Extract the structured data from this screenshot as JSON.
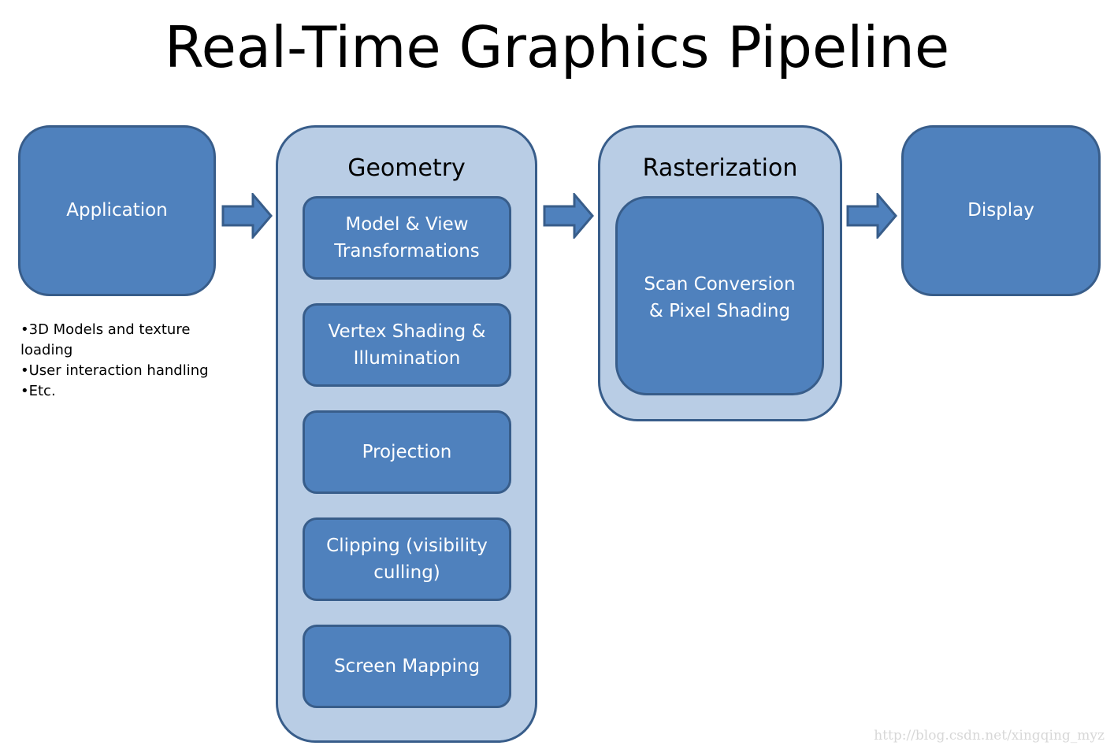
{
  "title": "Real-Time Graphics Pipeline",
  "stages": {
    "application": {
      "label": "Application"
    },
    "geometry": {
      "label": "Geometry",
      "steps": [
        "Model & View\nTransformations",
        "Vertex Shading &\nIllumination",
        "Projection",
        "Clipping (visibility\nculling)",
        "Screen Mapping"
      ]
    },
    "rasterization": {
      "label": "Rasterization",
      "steps": [
        "Scan Conversion\n& Pixel Shading"
      ]
    },
    "display": {
      "label": "Display"
    }
  },
  "application_notes": [
    "•3D Models and texture loading",
    "•User interaction handling",
    "•Etc."
  ],
  "watermark": "http://blog.csdn.net/xingqing_myz",
  "colors": {
    "box_fill": "#4f81bd",
    "box_border": "#385d8a",
    "container_fill": "#b9cde5"
  }
}
